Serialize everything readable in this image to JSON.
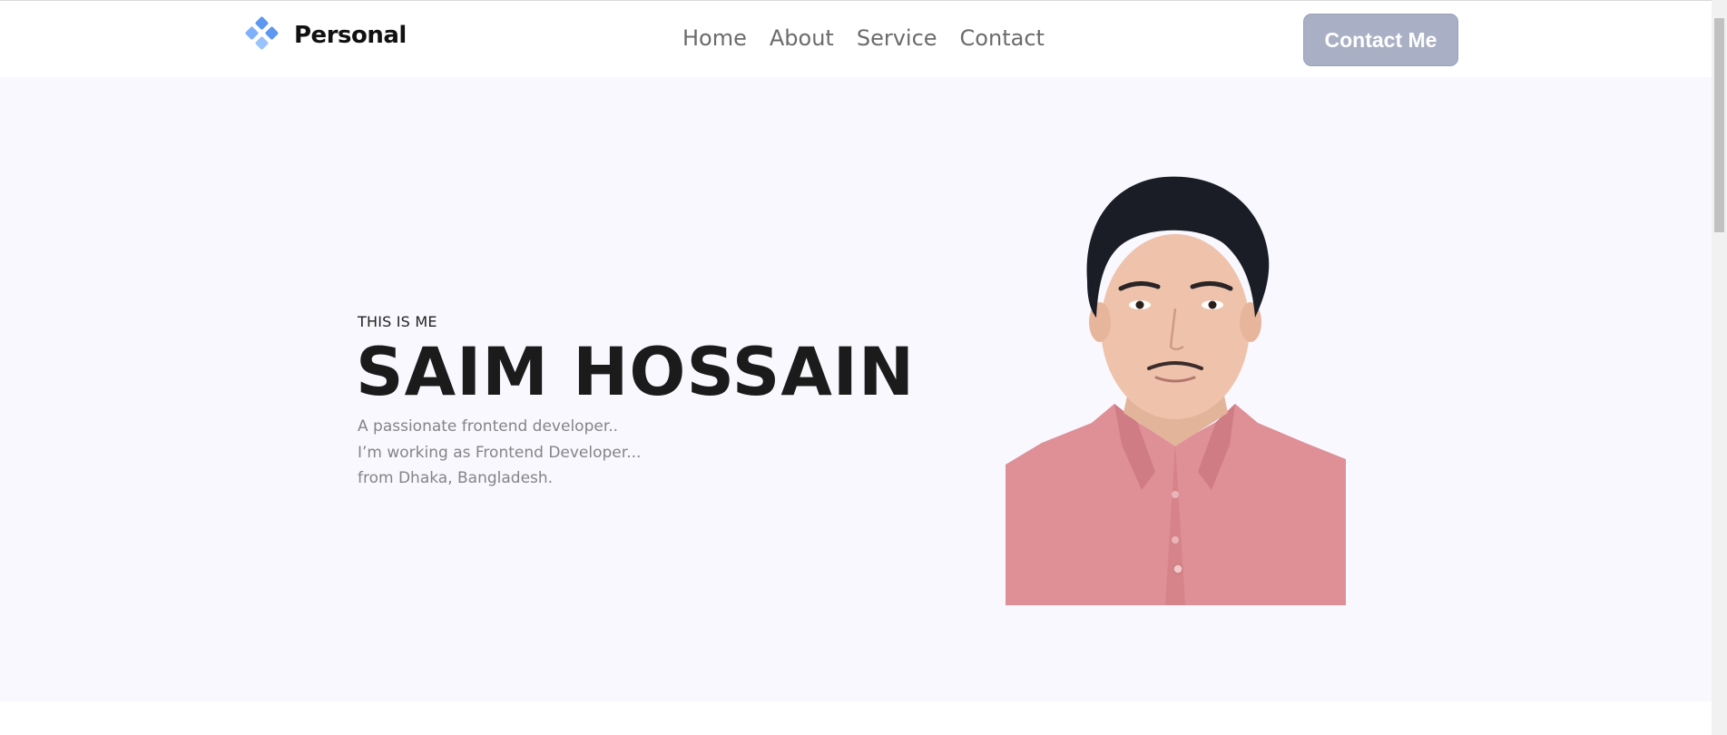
{
  "header": {
    "logo_text": "Personal",
    "logo_icon": "diamond-cluster-icon",
    "nav": [
      "Home",
      "About",
      "Service",
      "Contact"
    ],
    "cta_label": "Contact Me"
  },
  "hero": {
    "eyebrow": "THIS IS ME",
    "name": "SAIM HOSSAIN",
    "bio": [
      "A passionate frontend developer..",
      "I’m working as Frontend Developer...",
      "from Dhaka, Bangladesh."
    ],
    "portrait_icon": "portrait-photo"
  },
  "colors": {
    "accent": "#6ea8f7",
    "button_bg": "#a9afc4",
    "hero_bg": "#f8f8fe",
    "heading": "#1b1b1b",
    "muted": "#858585"
  }
}
